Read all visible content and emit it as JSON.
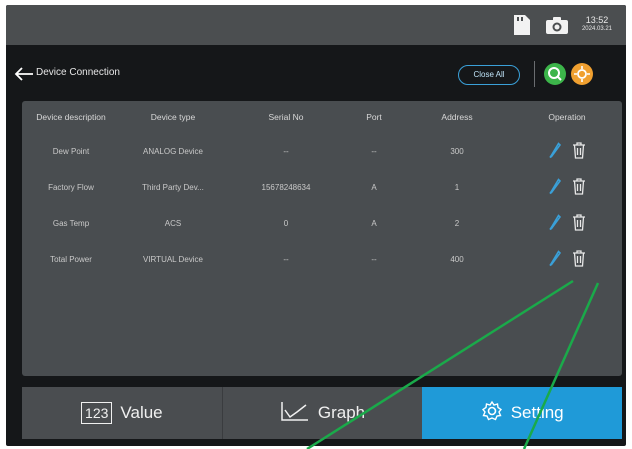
{
  "status": {
    "time": "13:52",
    "date": "2024.03.21"
  },
  "header": {
    "title": "Device Connection",
    "close_all_label": "Close All"
  },
  "table": {
    "columns": [
      "Device description",
      "Device type",
      "Serial No",
      "Port",
      "Address",
      "Operation"
    ],
    "rows": [
      [
        "Dew Point",
        "ANALOG Device",
        "--",
        "--",
        "300"
      ],
      [
        "Factory Flow",
        "Third Party Dev...",
        "15678248634",
        "A",
        "1"
      ],
      [
        "Gas Temp",
        "ACS",
        "0",
        "A",
        "2"
      ],
      [
        "Total Power",
        "VIRTUAL Device",
        "--",
        "--",
        "400"
      ]
    ]
  },
  "tabs": [
    {
      "label": "Value",
      "icon": "123-icon"
    },
    {
      "label": "Graph",
      "icon": "graph-line-icon"
    },
    {
      "label": "Setting",
      "icon": "gear-icon"
    }
  ],
  "colors": {
    "accent": "#1f9ad8",
    "edit": "#3aa0d8",
    "annotation": "#1aaa4a"
  }
}
